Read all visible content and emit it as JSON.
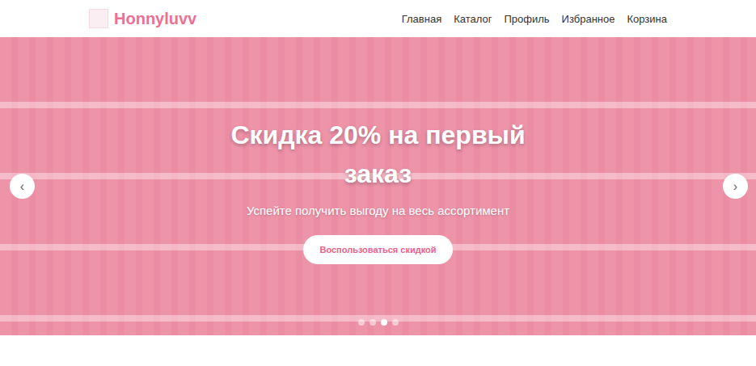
{
  "header": {
    "brand": "Honnyluvv",
    "nav": [
      "Главная",
      "Каталог",
      "Профиль",
      "Избранное",
      "Корзина"
    ]
  },
  "slider": {
    "title": "Скидка 20% на первый заказ",
    "subtitle": "Успейте получить выгоду на весь ассортимент",
    "button": "Воспользоваться скидкой",
    "prev": "‹",
    "next": "›",
    "dots": [
      {
        "selected": false
      },
      {
        "selected": false
      },
      {
        "selected": true
      },
      {
        "selected": false
      }
    ]
  }
}
